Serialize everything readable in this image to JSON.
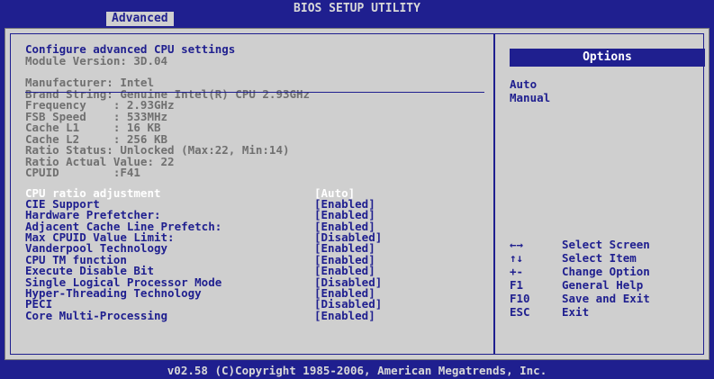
{
  "header": {
    "title": "BIOS SETUP UTILITY",
    "active_tab": "Advanced"
  },
  "left": {
    "heading": "Configure advanced CPU settings",
    "module_version": "Module Version: 3D.04",
    "info_lines": [
      "Manufacturer: Intel",
      "Brand String: Genuine Intel(R) CPU 2.93GHz",
      "Frequency    : 2.93GHz",
      "FSB Speed    : 533MHz",
      "Cache L1     : 16 KB",
      "Cache L2     : 256 KB",
      "Ratio Status: Unlocked (Max:22, Min:14)",
      "Ratio Actual Value: 22",
      "CPUID        :F41"
    ],
    "settings": [
      {
        "label": "CPU ratio adjustment",
        "value": "[Auto]",
        "selected": true
      },
      {
        "label": "CIE Support",
        "value": "[Enabled]"
      },
      {
        "label": "Hardware Prefetcher:",
        "value": "[Enabled]"
      },
      {
        "label": "Adjacent Cache Line Prefetch:",
        "value": "[Enabled]"
      },
      {
        "label": "Max CPUID Value Limit:",
        "value": "[Disabled]"
      },
      {
        "label": "Vanderpool Technology",
        "value": "[Enabled]"
      },
      {
        "label": "CPU TM function",
        "value": "[Enabled]"
      },
      {
        "label": "Execute Disable Bit",
        "value": "[Enabled]"
      },
      {
        "label": "Single Logical Processor Mode",
        "value": "[Disabled]"
      },
      {
        "label": "Hyper-Threading Technology",
        "value": "[Enabled]"
      },
      {
        "label": "PECI",
        "value": "[Disabled]"
      },
      {
        "label": "Core Multi-Processing",
        "value": "[Enabled]"
      }
    ]
  },
  "right": {
    "options_header": "Options",
    "options": [
      "Auto",
      "Manual"
    ],
    "keys": [
      {
        "key": "←→",
        "desc": "Select Screen"
      },
      {
        "key": "↑↓",
        "desc": "Select Item"
      },
      {
        "key": "+-",
        "desc": "Change Option"
      },
      {
        "key": "F1",
        "desc": "General Help"
      },
      {
        "key": "F10",
        "desc": "Save and Exit"
      },
      {
        "key": "ESC",
        "desc": "Exit"
      }
    ]
  },
  "footer": {
    "copyright": "v02.58 (C)Copyright 1985-2006, American Megatrends, Inc."
  },
  "colors": {
    "bg_blue": "#1f1f8f",
    "panel_gray": "#cfcfcf",
    "info_gray": "#707070",
    "highlight": "#ffffff"
  }
}
